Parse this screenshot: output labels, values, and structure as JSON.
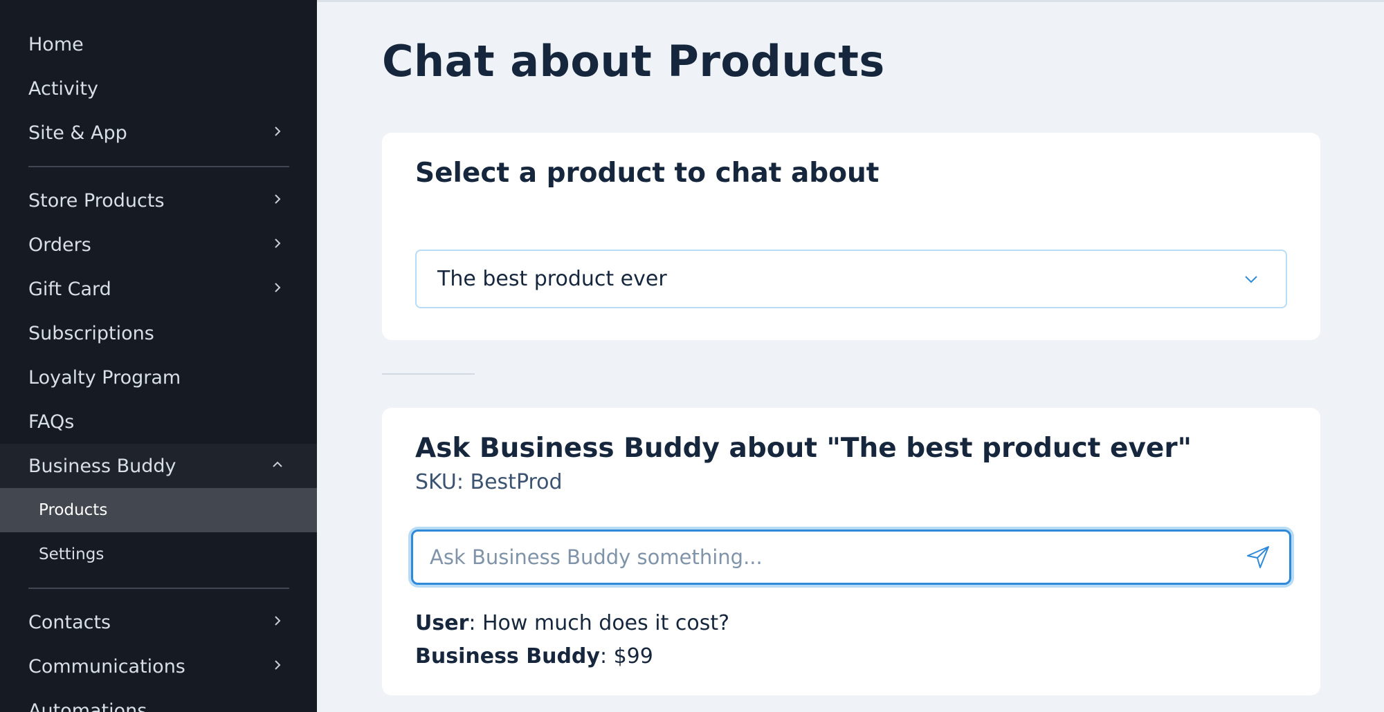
{
  "sidebar": {
    "items": [
      {
        "label": "Home",
        "has_chevron": false
      },
      {
        "label": "Activity",
        "has_chevron": false
      },
      {
        "label": "Site & App",
        "has_chevron": true
      },
      {
        "label": "Store Products",
        "has_chevron": true
      },
      {
        "label": "Orders",
        "has_chevron": true
      },
      {
        "label": "Gift Card",
        "has_chevron": true
      },
      {
        "label": "Subscriptions",
        "has_chevron": false
      },
      {
        "label": "Loyalty Program",
        "has_chevron": false
      },
      {
        "label": "FAQs",
        "has_chevron": false
      },
      {
        "label": "Business Buddy",
        "has_chevron": true,
        "expanded": true
      },
      {
        "label": "Contacts",
        "has_chevron": true
      },
      {
        "label": "Communications",
        "has_chevron": true
      },
      {
        "label": "Automations",
        "has_chevron": false
      }
    ],
    "sub_items": [
      {
        "label": "Products",
        "active": true
      },
      {
        "label": "Settings",
        "active": false
      }
    ]
  },
  "main": {
    "title": "Chat about Products",
    "select_card": {
      "title": "Select a product to chat about",
      "selected_product": "The best product ever"
    },
    "chat_card": {
      "title": "Ask Business Buddy about \"The best product ever\"",
      "sku": "SKU: BestProd",
      "input_placeholder": "Ask Business Buddy something...",
      "messages": [
        {
          "sender": "User",
          "text": ": How much does it cost?"
        },
        {
          "sender": "Business Buddy",
          "text": ": $99"
        }
      ]
    }
  },
  "colors": {
    "sidebar_bg": "#151a23",
    "active_item_bg": "#43474f",
    "page_bg": "#eff3f7",
    "title_text": "#16273d",
    "accent_blue": "#2e8ad8"
  },
  "icons": {
    "chevron_right": "chevron-right-icon",
    "chevron_up": "chevron-up-icon",
    "chevron_down": "chevron-down-icon",
    "send": "send-icon"
  }
}
